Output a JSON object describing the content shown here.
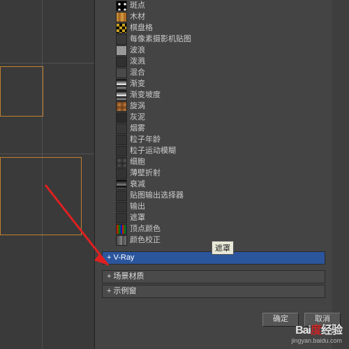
{
  "tree_items": [
    {
      "label": "斑点",
      "swatch": "radial-gradient(circle, #fff 30%, #000 32%)"
    },
    {
      "label": "木材",
      "swatch": "linear-gradient(90deg,#d8a040,#a06020,#d8a040)"
    },
    {
      "label": "棋盘格",
      "swatch": "repeating-conic-gradient(#000 0 25%, #c8a020 0 50%)"
    },
    {
      "label": "每像素摄影机贴图",
      "swatch": "#3a3a3a"
    },
    {
      "label": "波浪",
      "swatch": "repeating-linear-gradient(45deg,#888,#aaa 3px)"
    },
    {
      "label": "泼溅",
      "swatch": "#303030"
    },
    {
      "label": "混合",
      "swatch": "#4a4a4a"
    },
    {
      "label": "渐变",
      "swatch": "linear-gradient(#000,#fff)"
    },
    {
      "label": "渐变坡度",
      "swatch": "linear-gradient(#000,#fff)"
    },
    {
      "label": "旋涡",
      "swatch": "radial-gradient(#c08040,#603010)"
    },
    {
      "label": "灰泥",
      "swatch": "#2a2a2a"
    },
    {
      "label": "烟雾",
      "swatch": "#383838"
    },
    {
      "label": "粒子年龄",
      "swatch": "#333"
    },
    {
      "label": "粒子运动模糊",
      "swatch": "#333"
    },
    {
      "label": "细胞",
      "swatch": "radial-gradient(#555,#222)"
    },
    {
      "label": "薄壁折射",
      "swatch": "#333"
    },
    {
      "label": "衰减",
      "swatch": "linear-gradient(#000,#888)"
    },
    {
      "label": "贴图输出选择器",
      "swatch": "#333"
    },
    {
      "label": "输出",
      "swatch": "#333"
    },
    {
      "label": "遮罩",
      "swatch": "#333"
    },
    {
      "label": "顶点颜色",
      "swatch": "linear-gradient(90deg,red,green,blue)"
    },
    {
      "label": "颜色校正",
      "swatch": "linear-gradient(90deg,#444,#888)"
    }
  ],
  "tooltip": "遮罩",
  "expanders": {
    "vray": "+ V-Ray",
    "scene": "+ 场景材质",
    "sample": "+ 示例窗"
  },
  "buttons": {
    "ok": "确定",
    "cancel": "取消"
  },
  "watermark": {
    "logo": "Bai",
    "logo2": "经验",
    "url": "jingyan.baidu.com"
  }
}
